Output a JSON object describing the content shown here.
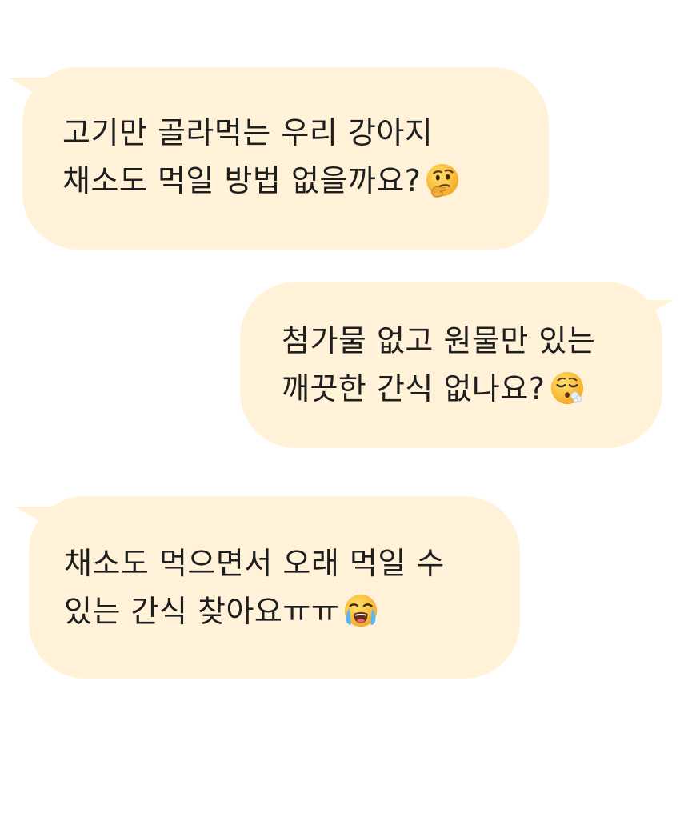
{
  "messages": [
    {
      "side": "left",
      "lines": [
        "고기만 골라먹는 우리 강아지",
        "채소도 먹일 방법 없을까요?"
      ],
      "emoji": "thinking-face"
    },
    {
      "side": "right",
      "lines": [
        "첨가물 없고 원물만 있는",
        "깨끗한 간식 없나요?"
      ],
      "emoji": "face-exhaling"
    },
    {
      "side": "left",
      "lines": [
        "채소도 먹으면서 오래 먹일 수",
        "있는 간식 찾아요ㅠㅠ"
      ],
      "emoji": "loudly-crying-face"
    }
  ],
  "colors": {
    "bubble": "#fff2d8",
    "text": "#1e1e1e",
    "background": "#ffffff"
  }
}
